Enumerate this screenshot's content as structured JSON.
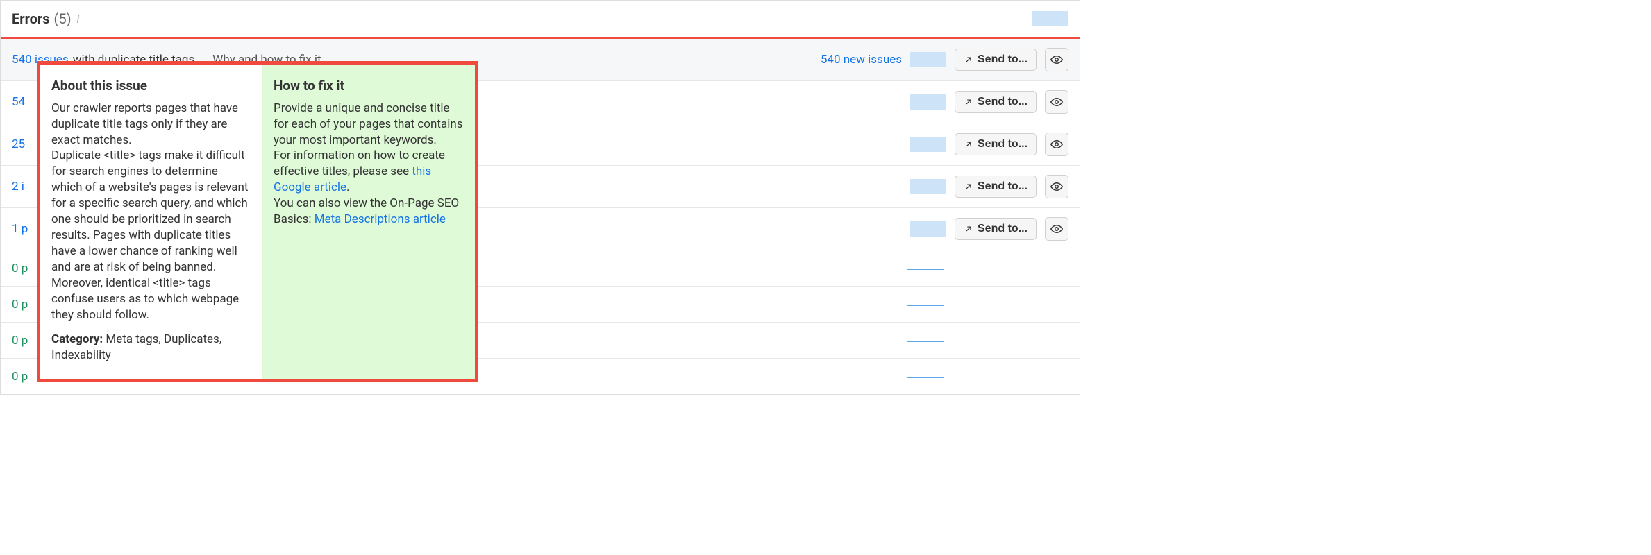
{
  "header": {
    "title": "Errors",
    "count": "(5)"
  },
  "buttons": {
    "send_to": "Send to..."
  },
  "rows": [
    {
      "count": "540 issues",
      "suffix": " with duplicate title tags",
      "how_link": "Why and how to fix it",
      "new_issues": "540 new issues",
      "kind": "expanded"
    },
    {
      "count": "54",
      "suffix": "",
      "kind": "issue"
    },
    {
      "count": "25",
      "suffix": "",
      "kind": "issue"
    },
    {
      "count": "2 i",
      "suffix": "",
      "kind": "issue"
    },
    {
      "count": "1 p",
      "suffix": "",
      "kind": "issue"
    },
    {
      "count": "0 p",
      "suffix": "",
      "kind": "zero"
    },
    {
      "count": "0 p",
      "suffix": "",
      "kind": "zero"
    },
    {
      "count": "0 p",
      "suffix": "",
      "kind": "zero"
    },
    {
      "count": "0 p",
      "suffix": "",
      "kind": "zero"
    }
  ],
  "popover": {
    "about_title": "About this issue",
    "about_p1": "Our crawler reports pages that have duplicate title tags only if they are exact matches.",
    "about_p2": "Duplicate <title> tags make it difficult for search engines to determine which of a website's pages is relevant for a specific search query, and which one should be prioritized in search results. Pages with duplicate titles have a lower chance of ranking well and are at risk of being banned.",
    "about_p3": "Moreover, identical <title> tags confuse users as to which webpage they should follow.",
    "category_label": "Category: ",
    "category_value": "Meta tags, Duplicates, Indexability",
    "fix_title": "How to fix it",
    "fix_p1": "Provide a unique and concise title for each of your pages that contains your most important keywords.",
    "fix_p2_pre": "For information on how to create effective titles, please see ",
    "fix_p2_link": "this Google article",
    "fix_p2_post": ".",
    "fix_p3_pre": "You can also view the On-Page SEO Basics: ",
    "fix_p3_link": "Meta Descriptions article"
  }
}
